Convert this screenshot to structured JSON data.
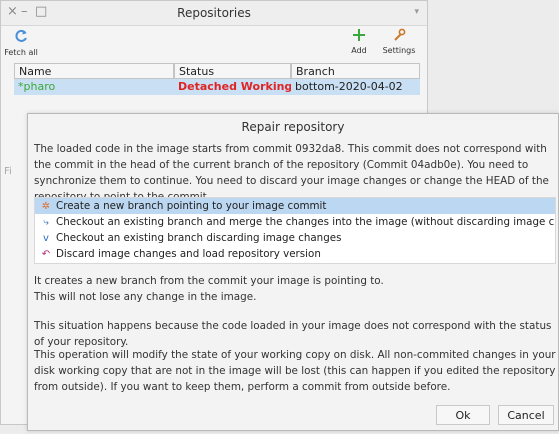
{
  "repositories": {
    "title": "Repositories",
    "controls": {
      "close": "×",
      "minimize": "–",
      "maximize": "□",
      "menu": "▾"
    },
    "toolbar": {
      "fetch_all": {
        "label": "Fetch all",
        "icon": "refresh-icon",
        "color": "#4a90d9"
      },
      "add": {
        "label": "Add",
        "icon": "plus-icon",
        "color": "#3aa83a"
      },
      "settings": {
        "label": "Settings",
        "icon": "wrench-icon",
        "color": "#c87a2a"
      }
    },
    "table": {
      "headers": [
        "Name",
        "Status",
        "Branch"
      ],
      "rows": [
        {
          "name": "*pharo",
          "status": "Detached Working Copy",
          "branch": "bottom-2020-04-02"
        }
      ],
      "name_color": "#3aa83a",
      "status_color": "#e02424",
      "selected_row_color": "#c9dff3"
    },
    "hidden_label_stub": "Fi"
  },
  "dialog": {
    "title": "Repair repository",
    "description": "The loaded code in the image starts from commit 0932da8. This commit does not correspond with the commit in the head of the current branch of the repository (Commit 04adb0e). You need to synchronize them to continue. You need to discard your image changes or change the HEAD of the repository to point to the commit.",
    "options": [
      {
        "label": "Create a new branch pointing to your image commit",
        "icon": "branch-new-icon",
        "glyph": "✲",
        "color": "#e26b2b"
      },
      {
        "label": "Checkout an existing branch and merge the changes into the image (without discarding image changes)",
        "icon": "merge-icon",
        "glyph": "⤷",
        "color": "#2a6bbf"
      },
      {
        "label": "Checkout an existing branch discarding image changes",
        "icon": "checkout-icon",
        "glyph": "ⅴ",
        "color": "#2a6bbf"
      },
      {
        "label": "Discard image changes and load repository version",
        "icon": "discard-icon",
        "glyph": "↶",
        "color": "#b0307a"
      }
    ],
    "selected_option": 0,
    "option_explanation_1": "It creates a new branch from the commit your image is pointing to.",
    "option_explanation_2": "This will not lose any change in the image.",
    "situation": "This situation happens because the code loaded in your image does not correspond with the status of your repository.",
    "warning": "This operation will modify the state of your working copy on disk. All non-commited changes in your disk working copy that are not in the image will be lost (this can happen if you edited the repository from outside). If you want to keep them, perform a commit from outside before.",
    "ok_label": "Ok",
    "cancel_label": "Cancel"
  }
}
